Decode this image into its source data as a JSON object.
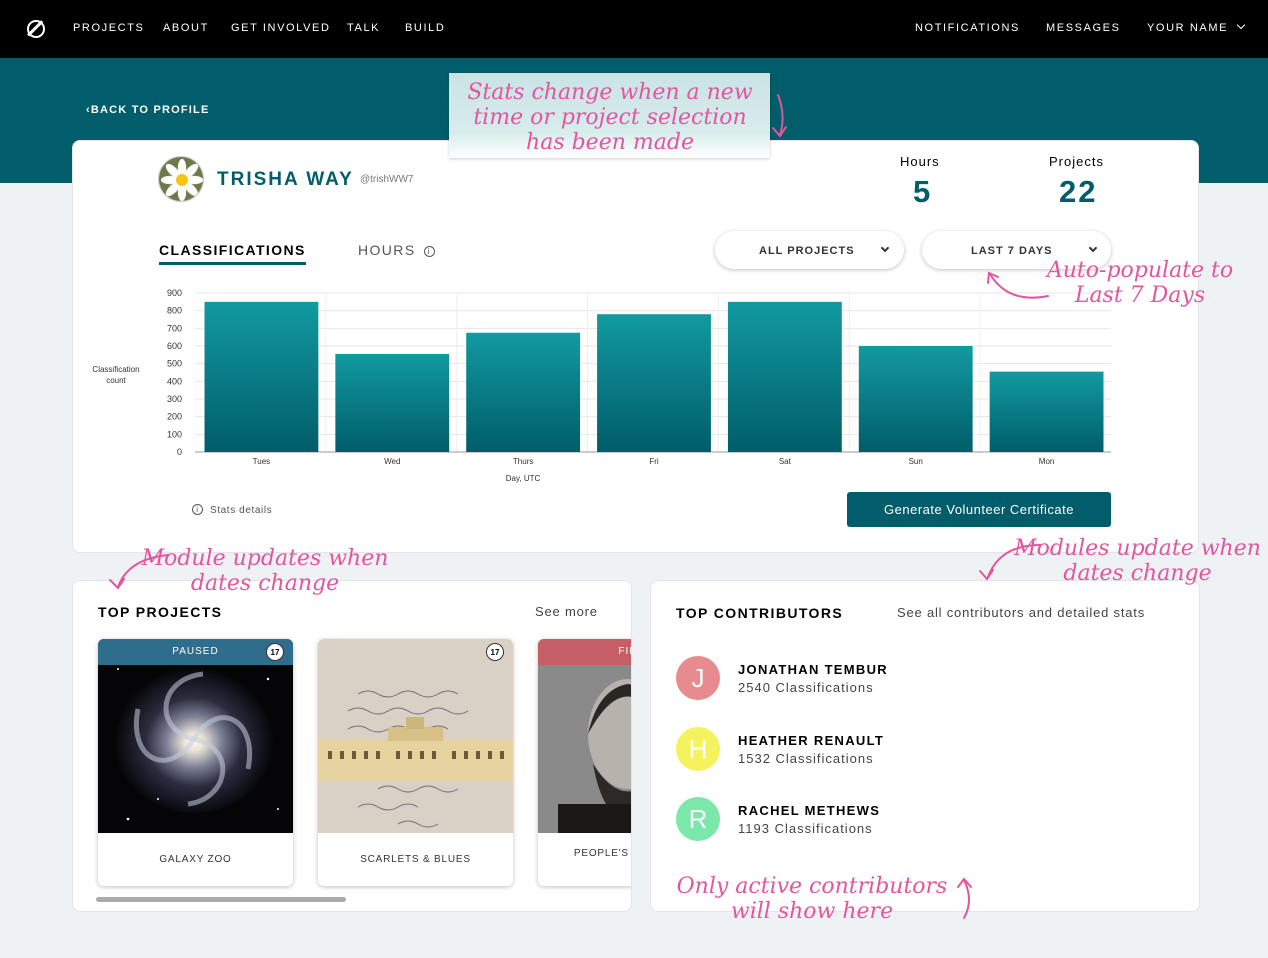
{
  "nav": {
    "logo_icon": "zooniverse-logo-icon",
    "links": [
      "PROJECTS",
      "ABOUT",
      "GET INVOLVED",
      "TALK",
      "BUILD"
    ],
    "right": [
      "NOTIFICATIONS",
      "MESSAGES"
    ],
    "user": "YOUR NAME"
  },
  "back_link": "BACK TO PROFILE",
  "profile": {
    "name": "TRISHA WAY",
    "handle": "@trishWW7"
  },
  "stats": {
    "hours_label": "Hours",
    "hours_value": "5",
    "projects_label": "Projects",
    "projects_value": "22"
  },
  "tabs": {
    "classifications": "CLASSIFICATIONS",
    "hours": "HOURS",
    "hours_info": "i"
  },
  "filters": {
    "project": "ALL PROJECTS",
    "range": "LAST 7 DAYS"
  },
  "chart_data": {
    "type": "bar",
    "categories": [
      "Tues",
      "Wed",
      "Thurs",
      "Fri",
      "Sat",
      "Sun",
      "Mon"
    ],
    "values": [
      850,
      555,
      675,
      780,
      850,
      600,
      455
    ],
    "xlabel": "Day, UTC",
    "ylabel": "Classification count",
    "ylim": [
      0,
      900
    ],
    "yticks": [
      0,
      100,
      200,
      300,
      400,
      500,
      600,
      700,
      800,
      900
    ],
    "grid": true,
    "bar_color_top": "#129aa1",
    "bar_color_bottom": "#005d69"
  },
  "stats_details": "Stats details",
  "certificate_button": "Generate Volunteer Certificate",
  "top_projects": {
    "title": "TOP PROJECTS",
    "see_more": "See more",
    "projects": [
      {
        "name": "GALAXY ZOO",
        "status": "PAUSED",
        "count": "17",
        "banner_color": "#2f6d8c"
      },
      {
        "name": "SCARLETS & BLUES",
        "status": "",
        "count": "17",
        "banner_color": ""
      },
      {
        "name": "PEOPLE'S CO... ARC...",
        "status": "FINI...",
        "count": "",
        "banner_color": "#c65e66"
      }
    ]
  },
  "top_contributors": {
    "title": "TOP CONTRIBUTORS",
    "see_all": "See all contributors and detailed stats",
    "contributors": [
      {
        "initial": "J",
        "name": "JONATHAN TEMBUR",
        "count": "2540 Classifications",
        "color": "#e88b8e"
      },
      {
        "initial": "H",
        "name": "HEATHER RENAULT",
        "count": "1532 Classifications",
        "color": "#f4f35e"
      },
      {
        "initial": "R",
        "name": "RACHEL METHEWS",
        "count": "1193 Classifications",
        "color": "#7be8ab"
      }
    ]
  },
  "annotations": {
    "sticky": "Stats change when a new time or project selection has been made",
    "auto_populate": "Auto-populate to Last 7 Days",
    "modules_left": "Module updates when dates change",
    "modules_right": "Modules update when dates change",
    "active_contributors": "Only active contributors will show here",
    "color": "#e2569f"
  }
}
